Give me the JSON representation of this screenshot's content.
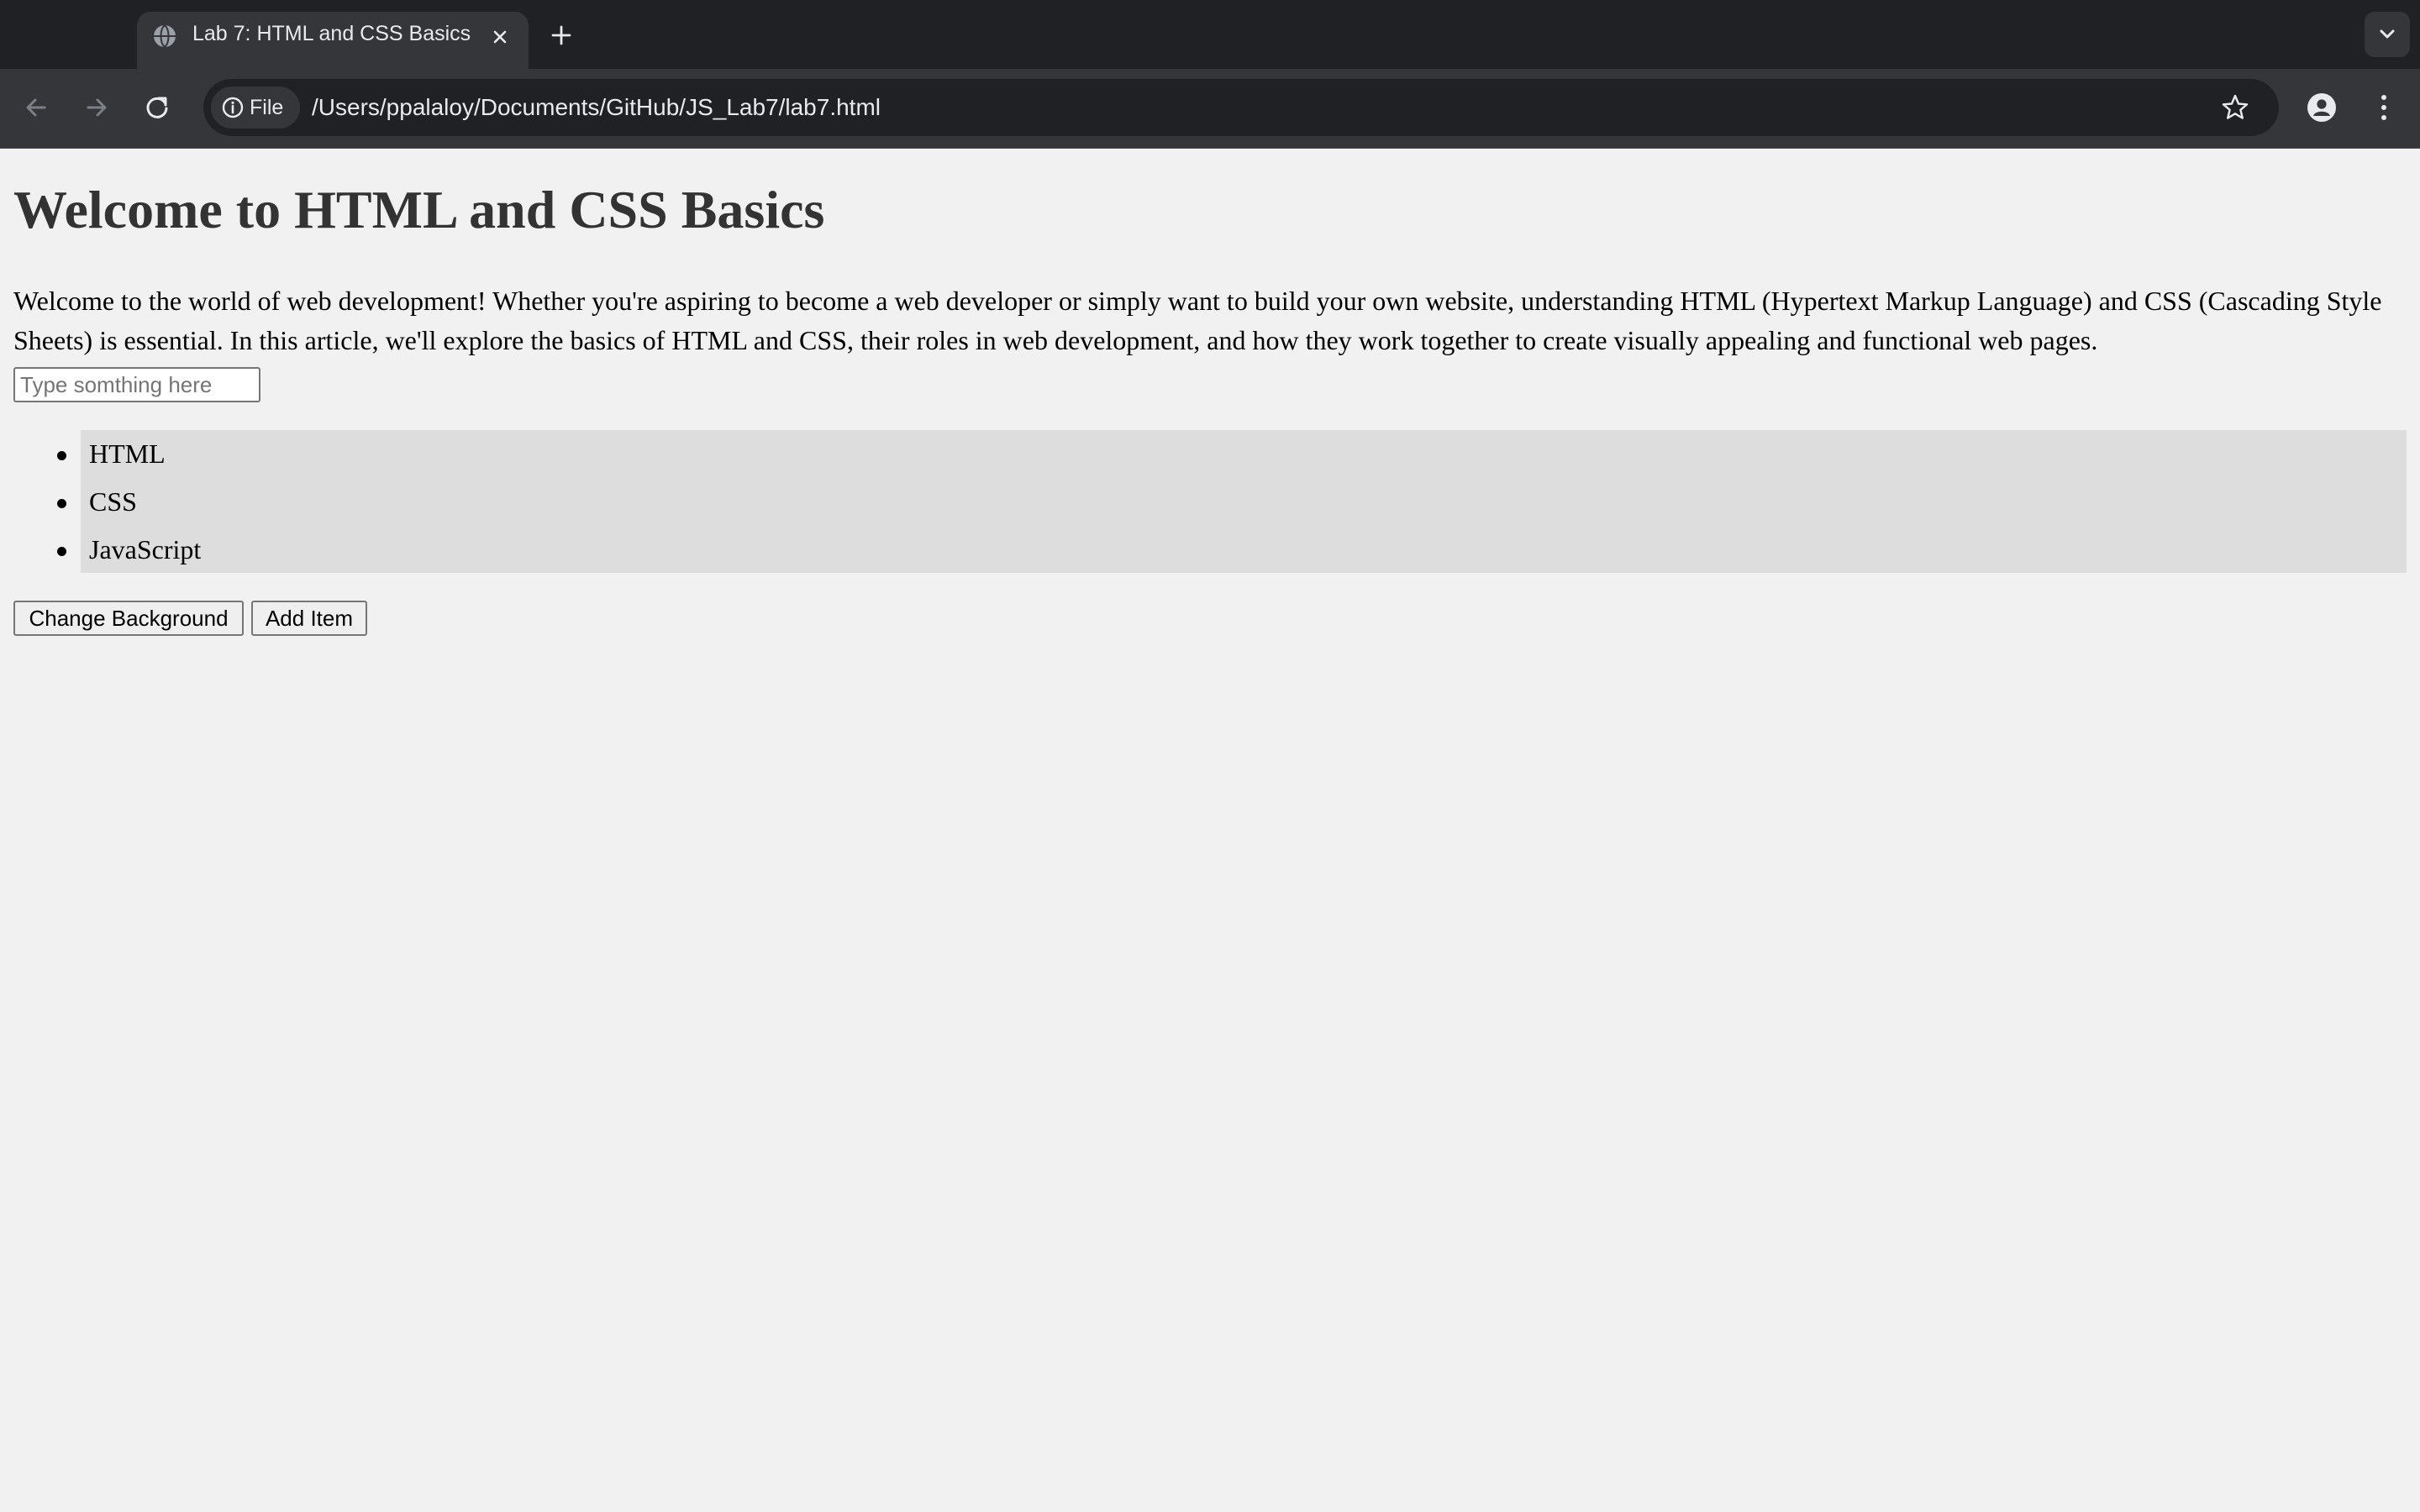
{
  "browser": {
    "tab": {
      "title": "Lab 7: HTML and CSS Basics",
      "favicon": "globe-icon"
    },
    "toolbar": {
      "site_chip_label": "File",
      "url": "/Users/ppalaloy/Documents/GitHub/JS_Lab7/lab7.html"
    },
    "icons": {
      "back": "arrow-left-icon",
      "forward": "arrow-right-icon",
      "reload": "reload-icon",
      "info": "info-icon",
      "bookmark": "star-icon",
      "profile": "profile-icon",
      "menu": "more-vertical-icon",
      "new_tab": "plus-icon",
      "tab_search": "chevron-down-icon",
      "close": "close-icon"
    },
    "colors": {
      "tabstrip": "#202124",
      "toolbar": "#35363a",
      "omnibox": "#202124",
      "text": "#e8eaed"
    }
  },
  "page": {
    "title": "Welcome to HTML and CSS Basics",
    "intro": "Welcome to the world of web development! Whether you're aspiring to become a web developer or simply want to build your own website, understanding HTML (Hypertext Markup Language) and CSS (Cascading Style Sheets) is essential. In this article, we'll explore the basics of HTML and CSS, their roles in web development, and how they work together to create visually appealing and functional web pages.",
    "input": {
      "value": "",
      "placeholder": "Type somthing here"
    },
    "list": [
      "HTML",
      "CSS",
      "JavaScript"
    ],
    "buttons": {
      "change_background": "Change Background",
      "add_item": "Add Item"
    },
    "colors": {
      "background": "#f1f1f1",
      "title": "#333333",
      "list_background": "#dddddd"
    }
  }
}
